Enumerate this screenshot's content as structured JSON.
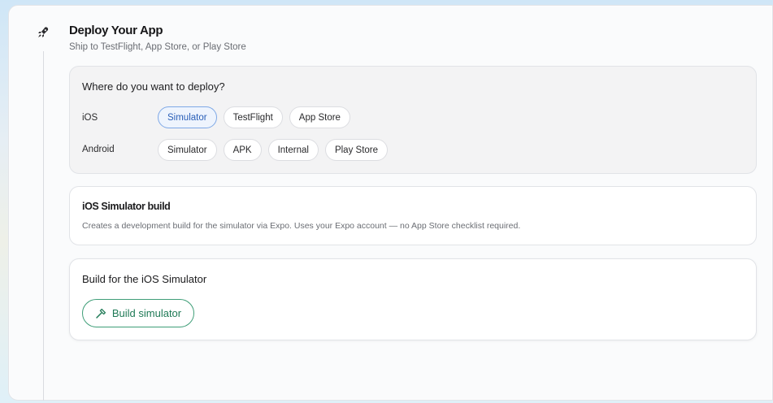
{
  "header": {
    "title": "Deploy Your App",
    "subtitle": "Ship to TestFlight, App Store, or Play Store"
  },
  "deploy_picker": {
    "question": "Where do you want to deploy?",
    "ios": {
      "label": "iOS",
      "options": [
        "Simulator",
        "TestFlight",
        "App Store"
      ],
      "selected": "Simulator"
    },
    "android": {
      "label": "Android",
      "options": [
        "Simulator",
        "APK",
        "Internal",
        "Play Store"
      ]
    }
  },
  "info": {
    "title": "iOS Simulator build",
    "description": "Creates a development build for the simulator via Expo. Uses your Expo account — no App Store checklist required."
  },
  "build": {
    "title": "Build for the iOS Simulator",
    "button_label": "Build simulator"
  },
  "colors": {
    "accent_blue": "#2a5fb8",
    "accent_green": "#1f7a56"
  },
  "icons": {
    "step": "rocket-icon",
    "build_button": "hammer-icon"
  }
}
